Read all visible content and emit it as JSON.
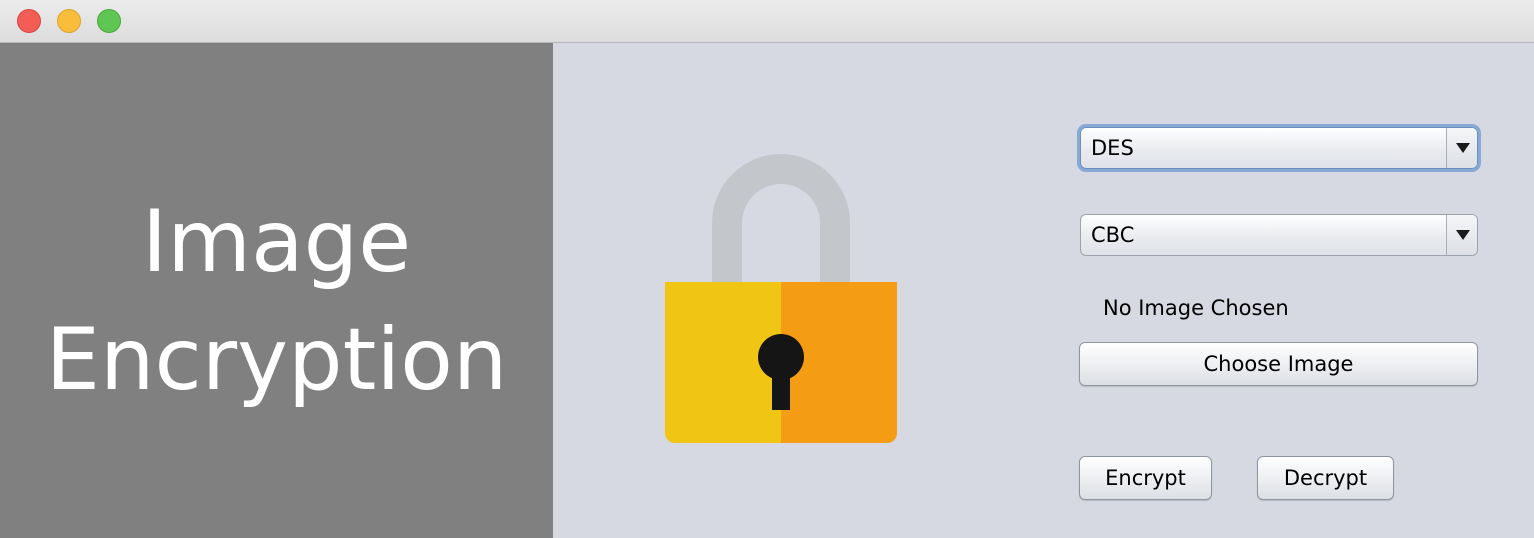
{
  "window": {
    "controls": [
      "close",
      "minimize",
      "maximize"
    ]
  },
  "sidebar": {
    "title_line1": "Image",
    "title_line2": "Encryption"
  },
  "lock_icon": {
    "shackle_color": "#c3c7cc",
    "body_left_color": "#f0c514",
    "body_right_color": "#f39c14",
    "keyhole_color": "#151515"
  },
  "form": {
    "algorithm_select": {
      "selected": "DES"
    },
    "mode_select": {
      "selected": "CBC"
    },
    "status_text": "No Image Chosen",
    "choose_button_label": "Choose Image",
    "encrypt_button_label": "Encrypt",
    "decrypt_button_label": "Decrypt"
  }
}
